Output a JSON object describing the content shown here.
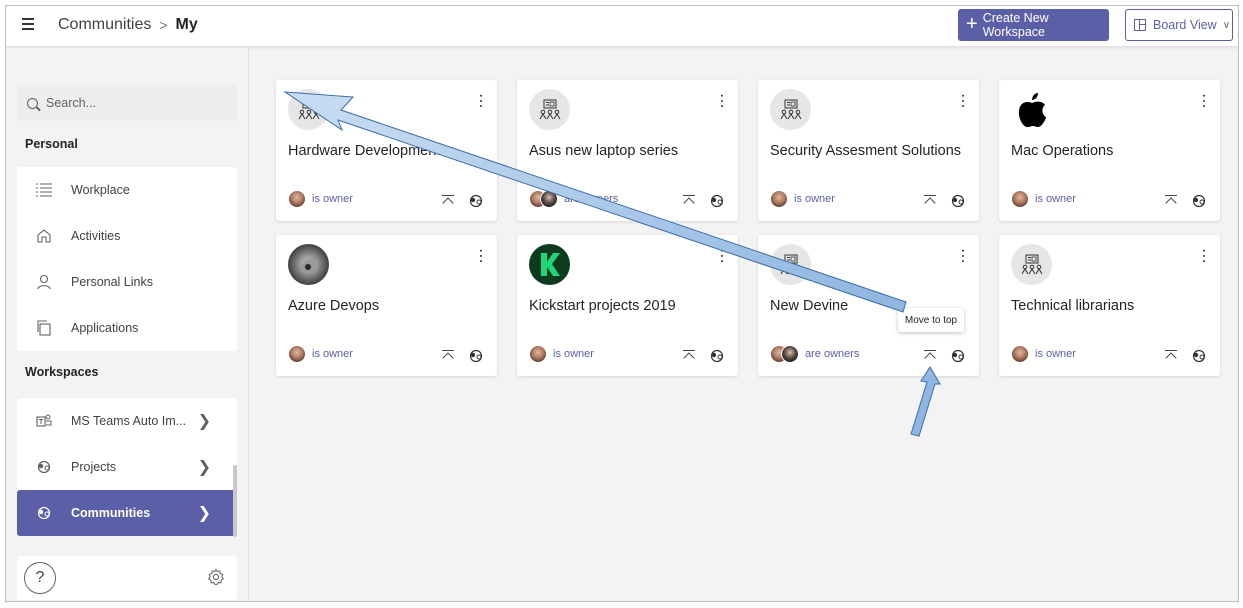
{
  "header": {
    "breadcrumb_parent": "Communities",
    "breadcrumb_separator": ">",
    "breadcrumb_current": "My",
    "create_label": "Create New Workspace",
    "view_label": "Board View"
  },
  "sidebar": {
    "search_placeholder": "Search...",
    "personal_label": "Personal",
    "personal_items": [
      {
        "label": "Workplace",
        "icon": "workplace-icon"
      },
      {
        "label": "Activities",
        "icon": "home-icon"
      },
      {
        "label": "Personal Links",
        "icon": "person-icon"
      },
      {
        "label": "Applications",
        "icon": "applications-icon"
      }
    ],
    "workspaces_label": "Workspaces",
    "workspace_items": [
      {
        "label": "MS Teams Auto Im...",
        "icon": "teams-icon"
      },
      {
        "label": "Projects",
        "icon": "projects-icon"
      },
      {
        "label": "Communities",
        "icon": "communities-icon",
        "active": true
      }
    ],
    "help_label": "?"
  },
  "cards": [
    {
      "title": "Hardware Development",
      "owner": "is owner",
      "avatar": "community-icon"
    },
    {
      "title": "Asus new laptop series",
      "owner": "are owners",
      "avatar": "community-icon"
    },
    {
      "title": "Security Assesment Solutions",
      "owner": "is owner",
      "avatar": "community-icon"
    },
    {
      "title": "Mac Operations",
      "owner": "is owner",
      "avatar": "apple-logo"
    },
    {
      "title": "Azure Devops",
      "owner": "is owner",
      "avatar": "photo"
    },
    {
      "title": "Kickstart projects 2019",
      "owner": "is owner",
      "avatar": "k-logo"
    },
    {
      "title": "New Devine",
      "owner": "are owners",
      "avatar": "community-icon"
    },
    {
      "title": "Technical librarians",
      "owner": "is owner",
      "avatar": "community-icon"
    }
  ],
  "tooltip": "Move to top",
  "colors": {
    "accent": "#5b5fa7",
    "background": "#f3f3f3",
    "annotation_arrow": "#9dc3e6"
  }
}
